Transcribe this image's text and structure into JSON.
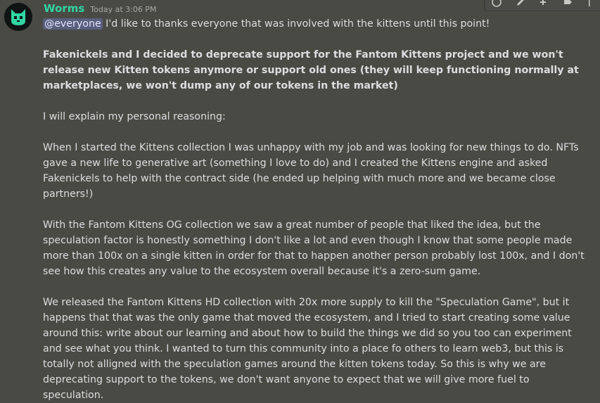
{
  "message": {
    "author": "Worms",
    "timestamp": "Today at 3:06 PM",
    "mention": "@everyone",
    "line1_rest": " I'd like to thanks everyone that was involved with the kittens until this point!",
    "announcement_bold": "Fakenickels and I decided to deprecate support for the Fantom Kittens project and we won't release new Kitten tokens anymore or support old ones (they will keep functioning normally at marketplaces, we won't dump any of our tokens in the market)",
    "para_reasoning": "I will explain my personal reasoning:",
    "para_started": "When I started the Kittens collection I was unhappy with my job and was looking for new things to do. NFTs gave a new life to generative art (something I love to do) and I created the Kittens engine and asked Fakenickels to help with the contract side (he ended up helping with much more and we became close partners!)",
    "para_og": "With the Fantom Kittens OG collection we saw a great number of people that liked the idea, but the speculation factor is honestly something I don't like a lot and even though I know that some people made more than 100x on a single kitten in order for that to happen another person probably lost 100x, and I don't see how this creates any value to the ecosystem overall because it's a zero-sum game.",
    "para_hd": "We released the Fantom Kittens HD collection with 20x more supply to kill the \"Speculation Game\", but it happens that that was the only game that moved the ecosystem, and I tried to start creating some value around this: write about our learning and about how to build the things we did so you too can experiment and see what you think. I wanted to turn this community into a place fo others to learn web3, but this is totally not alligned with the speculation games around the kitten tokens today. So this is why we are deprecating support to the tokens, we don't want anyone to expect that we will give more fuel to speculation."
  },
  "colors": {
    "background": "#4a4a45",
    "username": "#30d5a0",
    "text": "#dcddde",
    "mention_bg": "#5a5e7f",
    "avatar_bg": "#101314",
    "avatar_cat": "#30d5a0"
  },
  "toolbar_icons": [
    "add-reaction-icon",
    "edit-icon",
    "reply-icon",
    "thread-icon",
    "more-icon"
  ]
}
